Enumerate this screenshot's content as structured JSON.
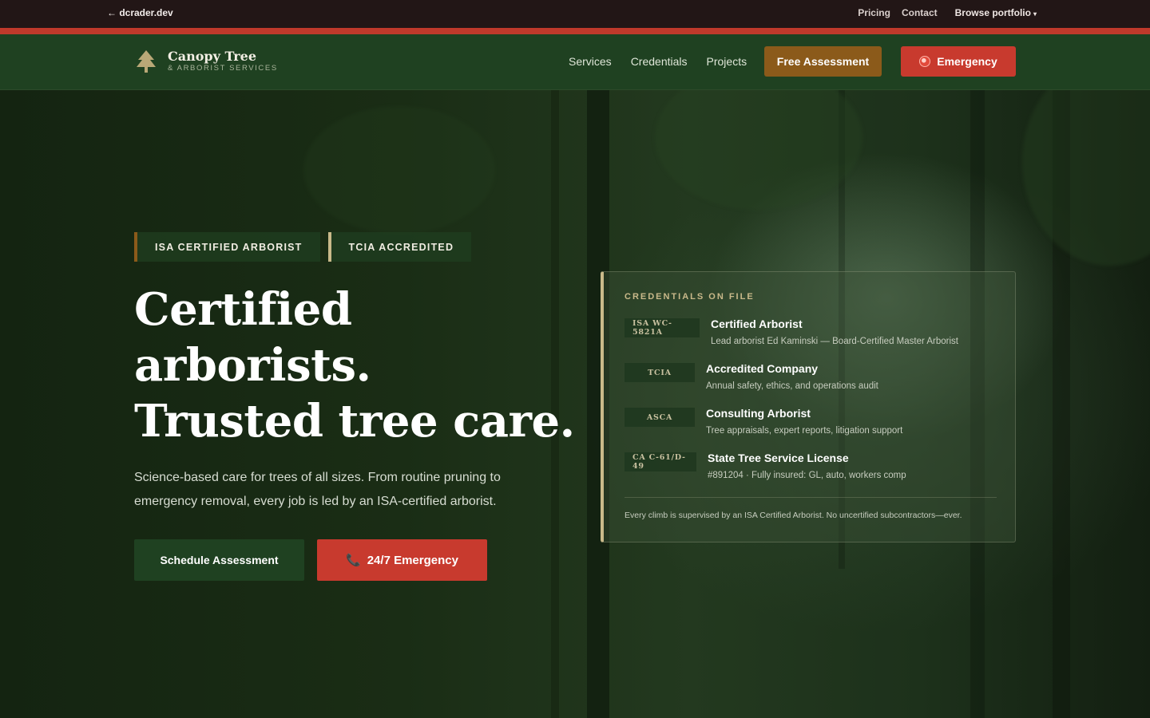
{
  "topbar": {
    "back_label": "← dcrader.dev",
    "links": [
      "Pricing",
      "Contact"
    ],
    "portfolio_label": "Browse portfolio",
    "portfolio_caret": "▾"
  },
  "brand": {
    "name": "Canopy Tree",
    "tagline": "& ARBORIST SERVICES"
  },
  "nav": {
    "links": [
      "Services",
      "Credentials",
      "Projects"
    ],
    "assessment_label": "Free Assessment",
    "emergency_label": "Emergency"
  },
  "hero": {
    "badges": [
      "ISA CERTIFIED ARBORIST",
      "TCIA ACCREDITED"
    ],
    "headline_lines": [
      "Certified",
      "arborists.",
      "Trusted tree care."
    ],
    "subtext": "Science-based care for trees of all sizes. From routine pruning to emergency removal, every job is led by an ISA-certified arborist.",
    "primary_cta": "Schedule Assessment",
    "secondary_cta": "24/7 Emergency",
    "phone_icon": "📞"
  },
  "credentials": {
    "heading": "CREDENTIALS ON FILE",
    "items": [
      {
        "code": "ISA WC-5821A",
        "title": "Certified Arborist",
        "desc": "Lead arborist Ed Kaminski — Board-Certified Master Arborist"
      },
      {
        "code": "TCIA",
        "title": "Accredited Company",
        "desc": "Annual safety, ethics, and operations audit"
      },
      {
        "code": "ASCA",
        "title": "Consulting Arborist",
        "desc": "Tree appraisals, expert reports, litigation support"
      },
      {
        "code": "CA C-61/D-49",
        "title": "State Tree Service License",
        "desc": "#891204 · Fully insured: GL, auto, workers comp"
      }
    ],
    "footnote": "Every climb is supervised by an ISA Certified Arborist. No uncertified subcontractors—ever."
  },
  "colors": {
    "nav_green": "#1f4121",
    "accent_brown": "#8b5a1a",
    "emergency_red": "#c83a2e",
    "gold": "#c9b98a"
  }
}
